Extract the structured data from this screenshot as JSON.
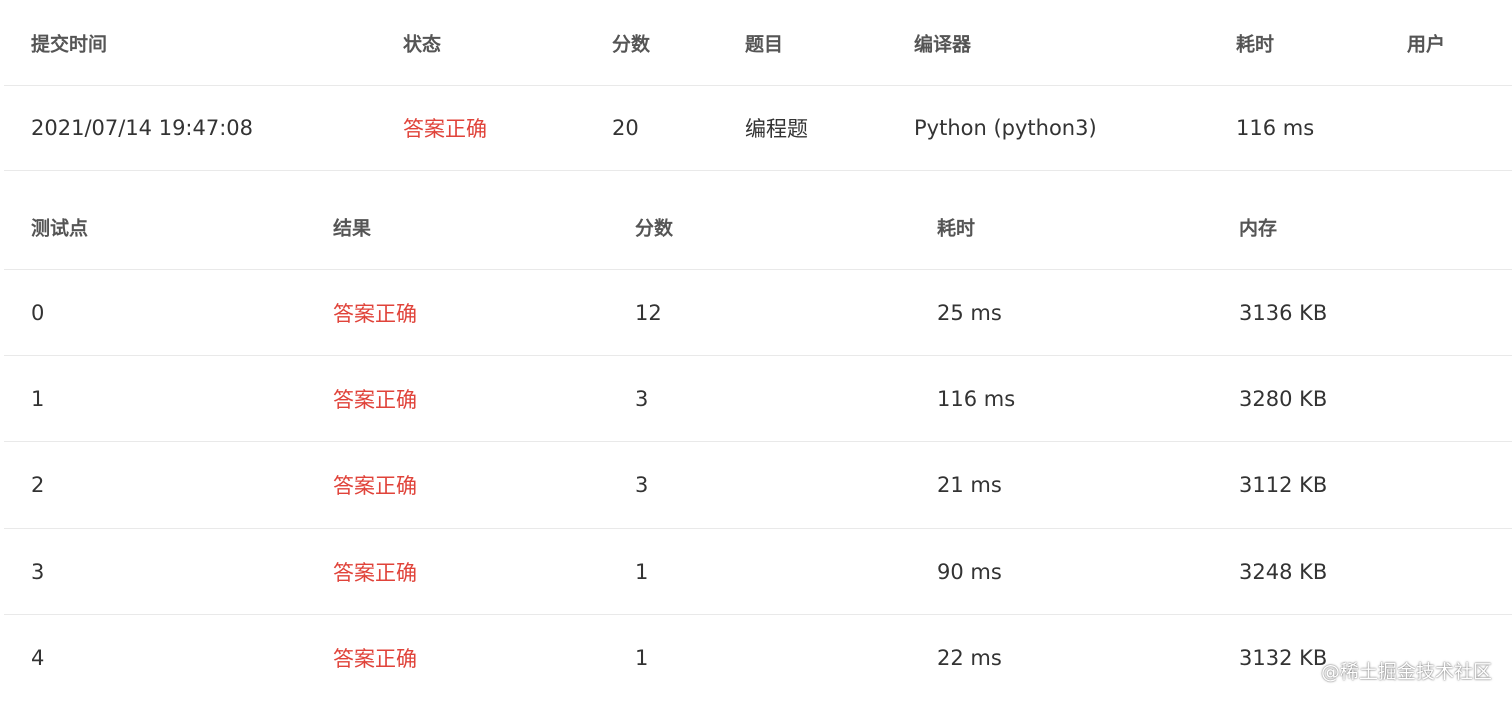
{
  "submission": {
    "headers": {
      "time": "提交时间",
      "status": "状态",
      "score": "分数",
      "problem": "题目",
      "compiler": "编译器",
      "elapsed": "耗时",
      "user": "用户"
    },
    "row": {
      "time": "2021/07/14 19:47:08",
      "status": "答案正确",
      "score": "20",
      "problem": "编程题",
      "compiler": "Python (python3)",
      "elapsed": "116 ms",
      "user": ""
    }
  },
  "testcases": {
    "headers": {
      "case": "测试点",
      "result": "结果",
      "score": "分数",
      "elapsed": "耗时",
      "memory": "内存"
    },
    "rows": [
      {
        "case": "0",
        "result": "答案正确",
        "score": "12",
        "elapsed": "25 ms",
        "memory": "3136 KB"
      },
      {
        "case": "1",
        "result": "答案正确",
        "score": "3",
        "elapsed": "116 ms",
        "memory": "3280 KB"
      },
      {
        "case": "2",
        "result": "答案正确",
        "score": "3",
        "elapsed": "21 ms",
        "memory": "3112 KB"
      },
      {
        "case": "3",
        "result": "答案正确",
        "score": "1",
        "elapsed": "90 ms",
        "memory": "3248 KB"
      },
      {
        "case": "4",
        "result": "答案正确",
        "score": "1",
        "elapsed": "22 ms",
        "memory": "3132 KB"
      }
    ]
  },
  "watermark": "@稀土掘金技术社区",
  "colors": {
    "accepted": "#e0433a",
    "header_text": "#555555",
    "body_text": "#333333",
    "divider": "#e9e9e9"
  }
}
